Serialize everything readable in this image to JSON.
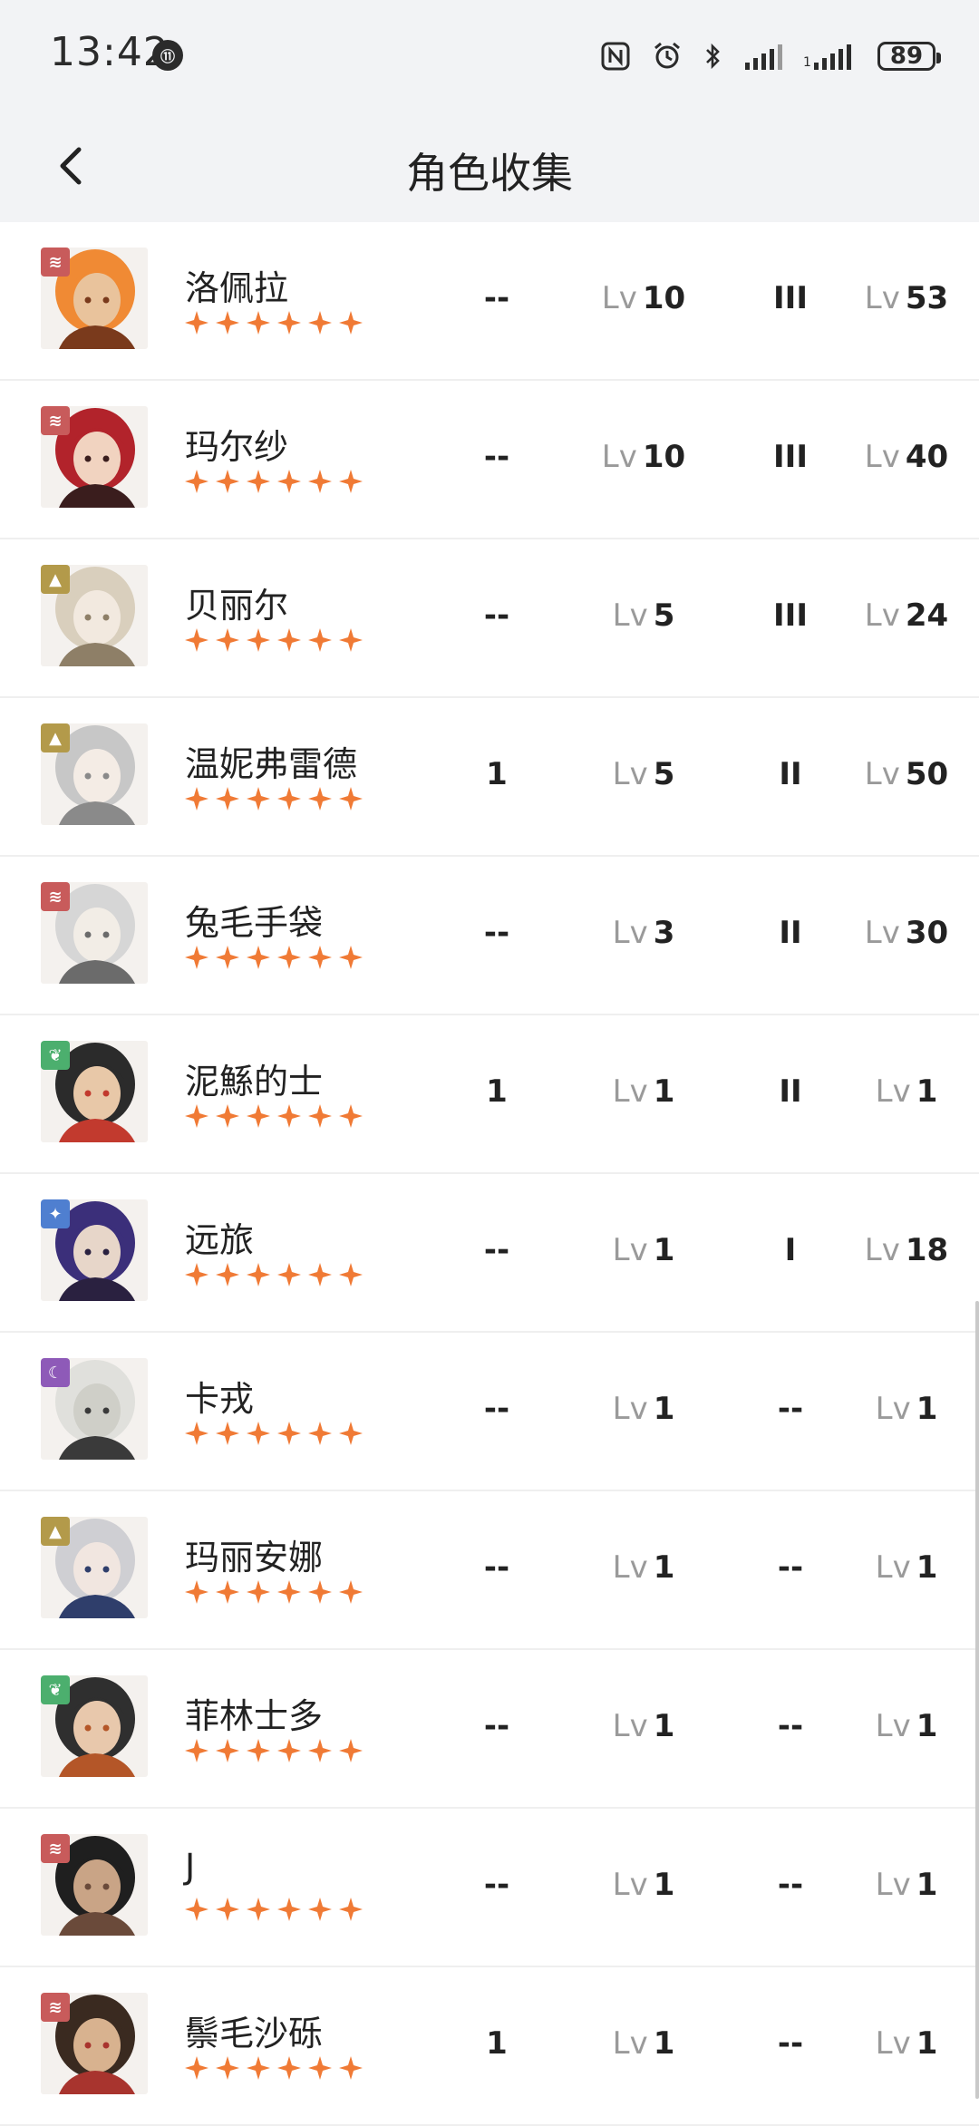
{
  "status": {
    "time": "13:42",
    "time_badge": "⑪",
    "battery": "89"
  },
  "header": {
    "title": "角色收集"
  },
  "colors": {
    "star": "#f07a35",
    "fire": "#c85b5b",
    "rock": "#b39a4a",
    "nature": "#4caf6e",
    "star_element": "#4f7fd0",
    "mystic": "#8e5ab8"
  },
  "characters": [
    {
      "name": "洛佩拉",
      "element": "fire",
      "stars": 6,
      "c1": "--",
      "lv_a": "10",
      "rank": "III",
      "lv_b": "53",
      "palette": [
        "#f08a34",
        "#7a3a1c",
        "#e9c39c"
      ]
    },
    {
      "name": "玛尔纱",
      "element": "fire",
      "stars": 6,
      "c1": "--",
      "lv_a": "10",
      "rank": "III",
      "lv_b": "40",
      "palette": [
        "#b2232b",
        "#3a1d1d",
        "#f1d3c0"
      ]
    },
    {
      "name": "贝丽尔",
      "element": "rock",
      "stars": 6,
      "c1": "--",
      "lv_a": "5",
      "rank": "III",
      "lv_b": "24",
      "palette": [
        "#d9cfbd",
        "#8e7f67",
        "#f2e9df"
      ]
    },
    {
      "name": "温妮弗雷德",
      "element": "rock",
      "stars": 6,
      "c1": "1",
      "lv_a": "5",
      "rank": "II",
      "lv_b": "50",
      "palette": [
        "#c7c7c7",
        "#8a8a8a",
        "#f4ece5"
      ]
    },
    {
      "name": "兔毛手袋",
      "element": "fire",
      "stars": 6,
      "c1": "--",
      "lv_a": "3",
      "rank": "II",
      "lv_b": "30",
      "palette": [
        "#d6d6d6",
        "#6b6b6b",
        "#f2ede6"
      ]
    },
    {
      "name": "泥鯀的士",
      "element": "nature",
      "stars": 6,
      "c1": "1",
      "lv_a": "1",
      "rank": "II",
      "lv_b": "1",
      "palette": [
        "#2b2b2b",
        "#c23a2e",
        "#e8c8a8"
      ]
    },
    {
      "name": "远旅",
      "element": "star_element",
      "stars": 6,
      "c1": "--",
      "lv_a": "1",
      "rank": "I",
      "lv_b": "18",
      "palette": [
        "#3b2f7a",
        "#2a2140",
        "#e7d6c9"
      ]
    },
    {
      "name": "卡戎",
      "element": "mystic",
      "stars": 6,
      "c1": "--",
      "lv_a": "1",
      "rank": "--",
      "lv_b": "1",
      "palette": [
        "#e0e0dc",
        "#3a3a3a",
        "#cfcfc8"
      ]
    },
    {
      "name": "玛丽安娜",
      "element": "rock",
      "stars": 6,
      "c1": "--",
      "lv_a": "1",
      "rank": "--",
      "lv_b": "1",
      "palette": [
        "#cfcfd3",
        "#2f3e6b",
        "#f1e6e0"
      ]
    },
    {
      "name": "菲林士多",
      "element": "nature",
      "stars": 6,
      "c1": "--",
      "lv_a": "1",
      "rank": "--",
      "lv_b": "1",
      "palette": [
        "#2f2f2f",
        "#b45628",
        "#e8c8ac"
      ]
    },
    {
      "name": "J",
      "element": "fire",
      "stars": 6,
      "c1": "--",
      "lv_a": "1",
      "rank": "--",
      "lv_b": "1",
      "palette": [
        "#1f1f1f",
        "#6a4a3a",
        "#c9a486"
      ]
    },
    {
      "name": "鬃毛沙砾",
      "element": "fire",
      "stars": 6,
      "c1": "1",
      "lv_a": "1",
      "rank": "--",
      "lv_b": "1",
      "palette": [
        "#3a2a20",
        "#a8342e",
        "#d8b28f"
      ]
    }
  ],
  "lv_prefix": "Lv"
}
